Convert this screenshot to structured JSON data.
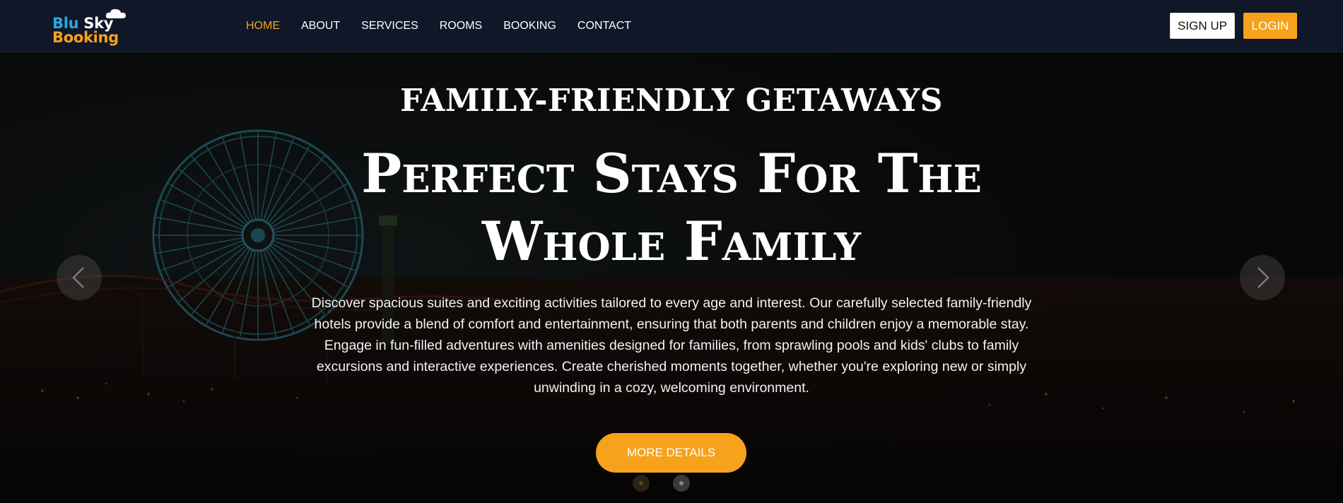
{
  "brand": {
    "word1": "Blu",
    "word2": "Sky",
    "word3": "Booking",
    "color_blue": "#29a8e0",
    "color_white": "#ffffff",
    "color_orange": "#f7a21b"
  },
  "nav": {
    "items": [
      {
        "label": "HOME",
        "active": true
      },
      {
        "label": "ABOUT",
        "active": false
      },
      {
        "label": "SERVICES",
        "active": false
      },
      {
        "label": "ROOMS",
        "active": false
      },
      {
        "label": "BOOKING",
        "active": false
      },
      {
        "label": "CONTACT",
        "active": false
      }
    ],
    "signup_label": "SIGN UP",
    "login_label": "LOGIN"
  },
  "hero": {
    "subtitle": "FAMILY-FRIENDLY GETAWAYS",
    "title_line1": "Perfect Stays For The",
    "title_line2": "Whole Family",
    "description": "Discover spacious suites and exciting activities tailored to every age and interest. Our carefully selected family-friendly hotels provide a blend of comfort and entertainment, ensuring that both parents and children enjoy a memorable stay. Engage in fun-filled adventures with amenities designed for families, from sprawling pools and kids' clubs to family excursions and interactive experiences. Create cherished moments together, whether you're exploring new or simply unwinding in a cozy, welcoming environment.",
    "cta_label": "MORE DETAILS",
    "background_image": "night-amusement-park-ferris-wheel"
  },
  "carousel": {
    "prev_icon": "chevron-left-icon",
    "next_icon": "chevron-right-icon",
    "slide_count": 2,
    "active_index": 0
  },
  "colors": {
    "navbar_bg": "#0f1728",
    "accent": "#f7a21b"
  }
}
